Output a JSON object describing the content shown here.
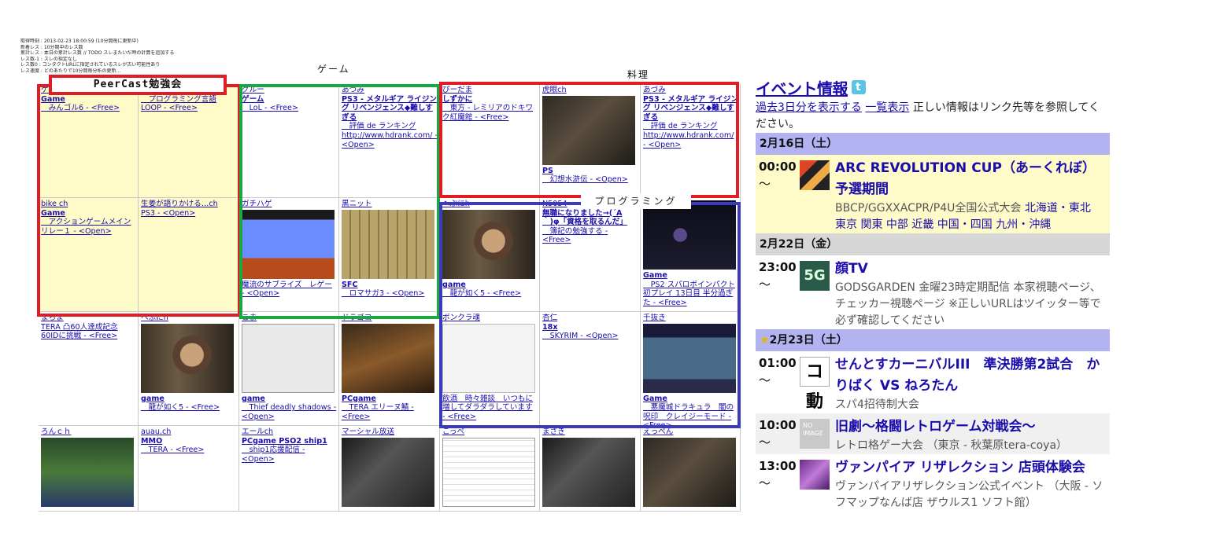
{
  "stats": [
    "取得時刻 : 2013-02-23 18:00:59 (10分間毎に更新中)",
    "新着レス : 10分間中のレス数",
    "累計レス : 本日の累計レス数 // TODO スレまたいだ時の計算を追加する",
    "レス数-1 : スレの指定なし",
    "レス数0 : コンタクトURLに指定されているスレが古い可能性あり",
    "レス速度 : どのあたりで10分間毎分析の更新..."
  ],
  "annotations": {
    "peercast": "PeerCast勉強会",
    "game": "ゲーム",
    "cooking": "料理",
    "programming": "プログラミング"
  },
  "cells": [
    {
      "name": "ゲレー",
      "genre": "Game",
      "detail": "　みんゴル6 - <Free>",
      "thumb": "",
      "yellow": true
    },
    {
      "name": "",
      "genre": "プログラミング",
      "detail": "　プログラミング言語 LOOP - <Free>",
      "thumb": "",
      "yellow": true
    },
    {
      "name": "グルー",
      "genre": "ゲーム",
      "detail": "　LoL - <Free>",
      "thumb": ""
    },
    {
      "name": "あづみ",
      "genre": "PS3 - メタルギア ライジング リベンジェンス◆難しすぎる",
      "detail": "　評価 de ランキング http://www.hdrank.com/ - <Open>",
      "thumb": ""
    },
    {
      "name": "ぴーだま",
      "genre": "しずかに",
      "detail": "　東方 - レミリアのドキワク紅魔館 - <Free>",
      "thumb": ""
    },
    {
      "name": "虎眼ch",
      "genre": "PS",
      "detail": "　幻想水滸伝 - <Open>",
      "thumb": "th-dark"
    },
    {
      "name": "あづみ",
      "genre": "PS3 - メタルギア ライジング リベンジェンス◆難しすぎる",
      "detail": "　評価 de ランキング http://www.hdrank.com/ - <Open>",
      "thumb": ""
    },
    {
      "name": "bike ch",
      "genre": "Game",
      "detail": "　アクションゲームメインリレー１ - <Open>",
      "thumb": "",
      "yellow": true
    },
    {
      "name": "生姜が語りかける…ch",
      "genre": "",
      "detail": "PS3 - <Open>",
      "thumb": "",
      "yellow": true
    },
    {
      "name": "ガチハゲ",
      "genre": "",
      "detail": "魔流のサブライズ　レゲー - <Open>",
      "thumb": "th-nes"
    },
    {
      "name": "黒ニット",
      "genre": "SFC",
      "detail": "　ロマサガ3 - <Open>",
      "thumb": "th-sfc"
    },
    {
      "name": "へぶにh",
      "genre": "game",
      "detail": "　龍が如く5 - <Free>",
      "thumb": "th-face"
    },
    {
      "name": "N5054",
      "genre": "無職になりました→(´A｀)φ「資格を取るんだ」",
      "detail": "　簿記の勉強する - <Free>",
      "thumb": ""
    },
    {
      "name": "",
      "genre": "Game",
      "detail": "　PS2 スパロボインパクト初プレイ 13日目 半分過ぎた - <Free>",
      "thumb": "th-space"
    },
    {
      "name": "まらま",
      "genre": "",
      "detail": "TERA 凸60人達成記念 60IDに挑戦 - <Free>",
      "thumb": ""
    },
    {
      "name": "へぶにh",
      "genre": "game",
      "detail": "　龍が如く5 - <Free>",
      "thumb": "th-face"
    },
    {
      "name": "こま",
      "genre": "game",
      "detail": "　Thief deadly shadows - <Open>",
      "thumb": "th-blank"
    },
    {
      "name": "ドラゴコ",
      "genre": "PCgame",
      "detail": "　TERA エリーヌ鯖 - <Free>",
      "thumb": "th-dungeon"
    },
    {
      "name": "ボンクラ魂",
      "genre": "",
      "detail": "飲酒　時々雑談　いつもに増してダラダラしています - <Free>",
      "thumb": "th-sketch"
    },
    {
      "name": "杏仁",
      "genre": "18x",
      "detail": "　SKYRIM - <Open>",
      "thumb": ""
    },
    {
      "name": "千抜き",
      "genre": "Game",
      "detail": "　悪魔城ドラキュラ　闇の呪印　クレイジーモード - <Free>",
      "thumb": "th-rpg"
    },
    {
      "name": "ろんｃｈ",
      "genre": "",
      "detail": "",
      "thumb": "th-sfcmap"
    },
    {
      "name": "auau.ch",
      "genre": "MMO",
      "detail": "　TERA - <Free>",
      "thumb": ""
    },
    {
      "name": "エールch",
      "genre": "PCgame PSO2 ship1",
      "detail": "　ship1応援配信 - <Open>",
      "thumb": ""
    },
    {
      "name": "マーシャル放送",
      "genre": "",
      "detail": "",
      "thumb": "th-game2"
    },
    {
      "name": "こっぺ",
      "genre": "",
      "detail": "",
      "thumb": "th-manga"
    },
    {
      "name": "まさき",
      "genre": "",
      "detail": "",
      "thumb": "th-game2"
    },
    {
      "name": "えっぺん",
      "genre": "",
      "detail": "",
      "thumb": "th-dark"
    }
  ],
  "events": {
    "title": "イベント情報",
    "show3days": "過去3日分を表示する",
    "listview": "一覧表示",
    "note": "正しい情報はリンク先等を参照してください。",
    "days": [
      {
        "date": "2月16日（土）",
        "star": false,
        "items": [
          {
            "time": "00:00",
            "tilde": "〜",
            "icon": "ic-arc",
            "icon_text": "",
            "name": "ARC REVOLUTION CUP（あーくれぼ）予選期間",
            "sub": "BBCP/GGXXACPR/P4U全国公式大会",
            "links": "北海道・東北 東京 関東 中部 近畿 中国・四国 九州・沖縄",
            "bg": "yellow"
          }
        ]
      },
      {
        "date": "2月22日（金）",
        "star": false,
        "items": [
          {
            "time": "23:00",
            "tilde": "〜",
            "icon": "ic-5g",
            "icon_text": "5G",
            "name": "顔TV",
            "sub": "GODSGARDEN 金曜23時定期配信 本家視聴ページ、チェッカー視聴ページ ※正しいURLはツイッター等で必ず確認してください",
            "links": "",
            "bg": "white"
          }
        ]
      },
      {
        "date": "2月23日（土）",
        "star": true,
        "items": [
          {
            "time": "01:00",
            "tilde": "〜",
            "icon": "ic-kanji",
            "icon_text": "コ動",
            "name": "せんとすカーニバルIII　準決勝第2試合　かりばく VS ねろたん",
            "sub": "スパ4招待制大会",
            "links": "",
            "bg": "white"
          },
          {
            "time": "10:00",
            "tilde": "〜",
            "icon": "ic-noimg",
            "icon_text": "NO IMAGE",
            "name": "旧劇〜格闘レトロゲーム対戦会〜",
            "sub": "レトロ格ゲー大会 （東京 - 秋葉原tera-coya）",
            "links": "",
            "bg": "gray"
          },
          {
            "time": "13:00",
            "tilde": "〜",
            "icon": "ic-vamp",
            "icon_text": "",
            "name": "ヴァンパイア リザレクション 店頭体験会",
            "sub": "ヴァンパイアリザレクション公式イベント （大阪 - ソフマップなんば店 ザウルス1 ソフト館）",
            "links": "",
            "bg": "white"
          }
        ]
      }
    ]
  }
}
